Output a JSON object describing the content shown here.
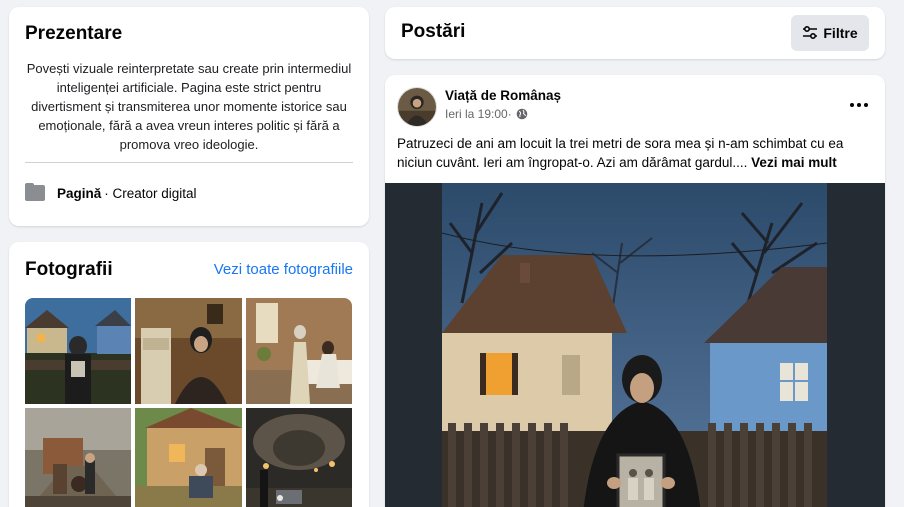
{
  "intro": {
    "title": "Prezentare",
    "bio": "Povești vizuale reinterpretate sau create prin intermediul inteligenței artificiale. Pagina este strict pentru divertisment și transmiterea unor momente istorice sau emoționale, fără a avea vreun interes politic și fără a promova vreo ideologie.",
    "category_label": "Pagină",
    "category_value": " · Creator digital",
    "category_icon": "page-icon"
  },
  "photos": {
    "title": "Fotografii",
    "see_all": "Vezi toate fotografiile",
    "items": [
      "photo-1",
      "photo-2",
      "photo-3",
      "photo-4",
      "photo-5",
      "photo-6"
    ]
  },
  "posts_header": {
    "title": "Postări",
    "filter_label": "Filtre",
    "filter_icon": "sliders-icon"
  },
  "post": {
    "author": "Viață de Românaș",
    "time": "Ieri la 19:00",
    "separator": " · ",
    "privacy_icon": "globe-icon",
    "text": "Patruzeci de ani am locuit la trei metri de sora mea și n-am schimbat cu ea niciun cuvânt. Ieri am îngropat-o. Azi am dărâmat gardul.... ",
    "see_more": "Vezi mai mult"
  },
  "colors": {
    "link": "#1877f2",
    "background": "#f0f2f5",
    "secondary_text": "#65676b"
  }
}
